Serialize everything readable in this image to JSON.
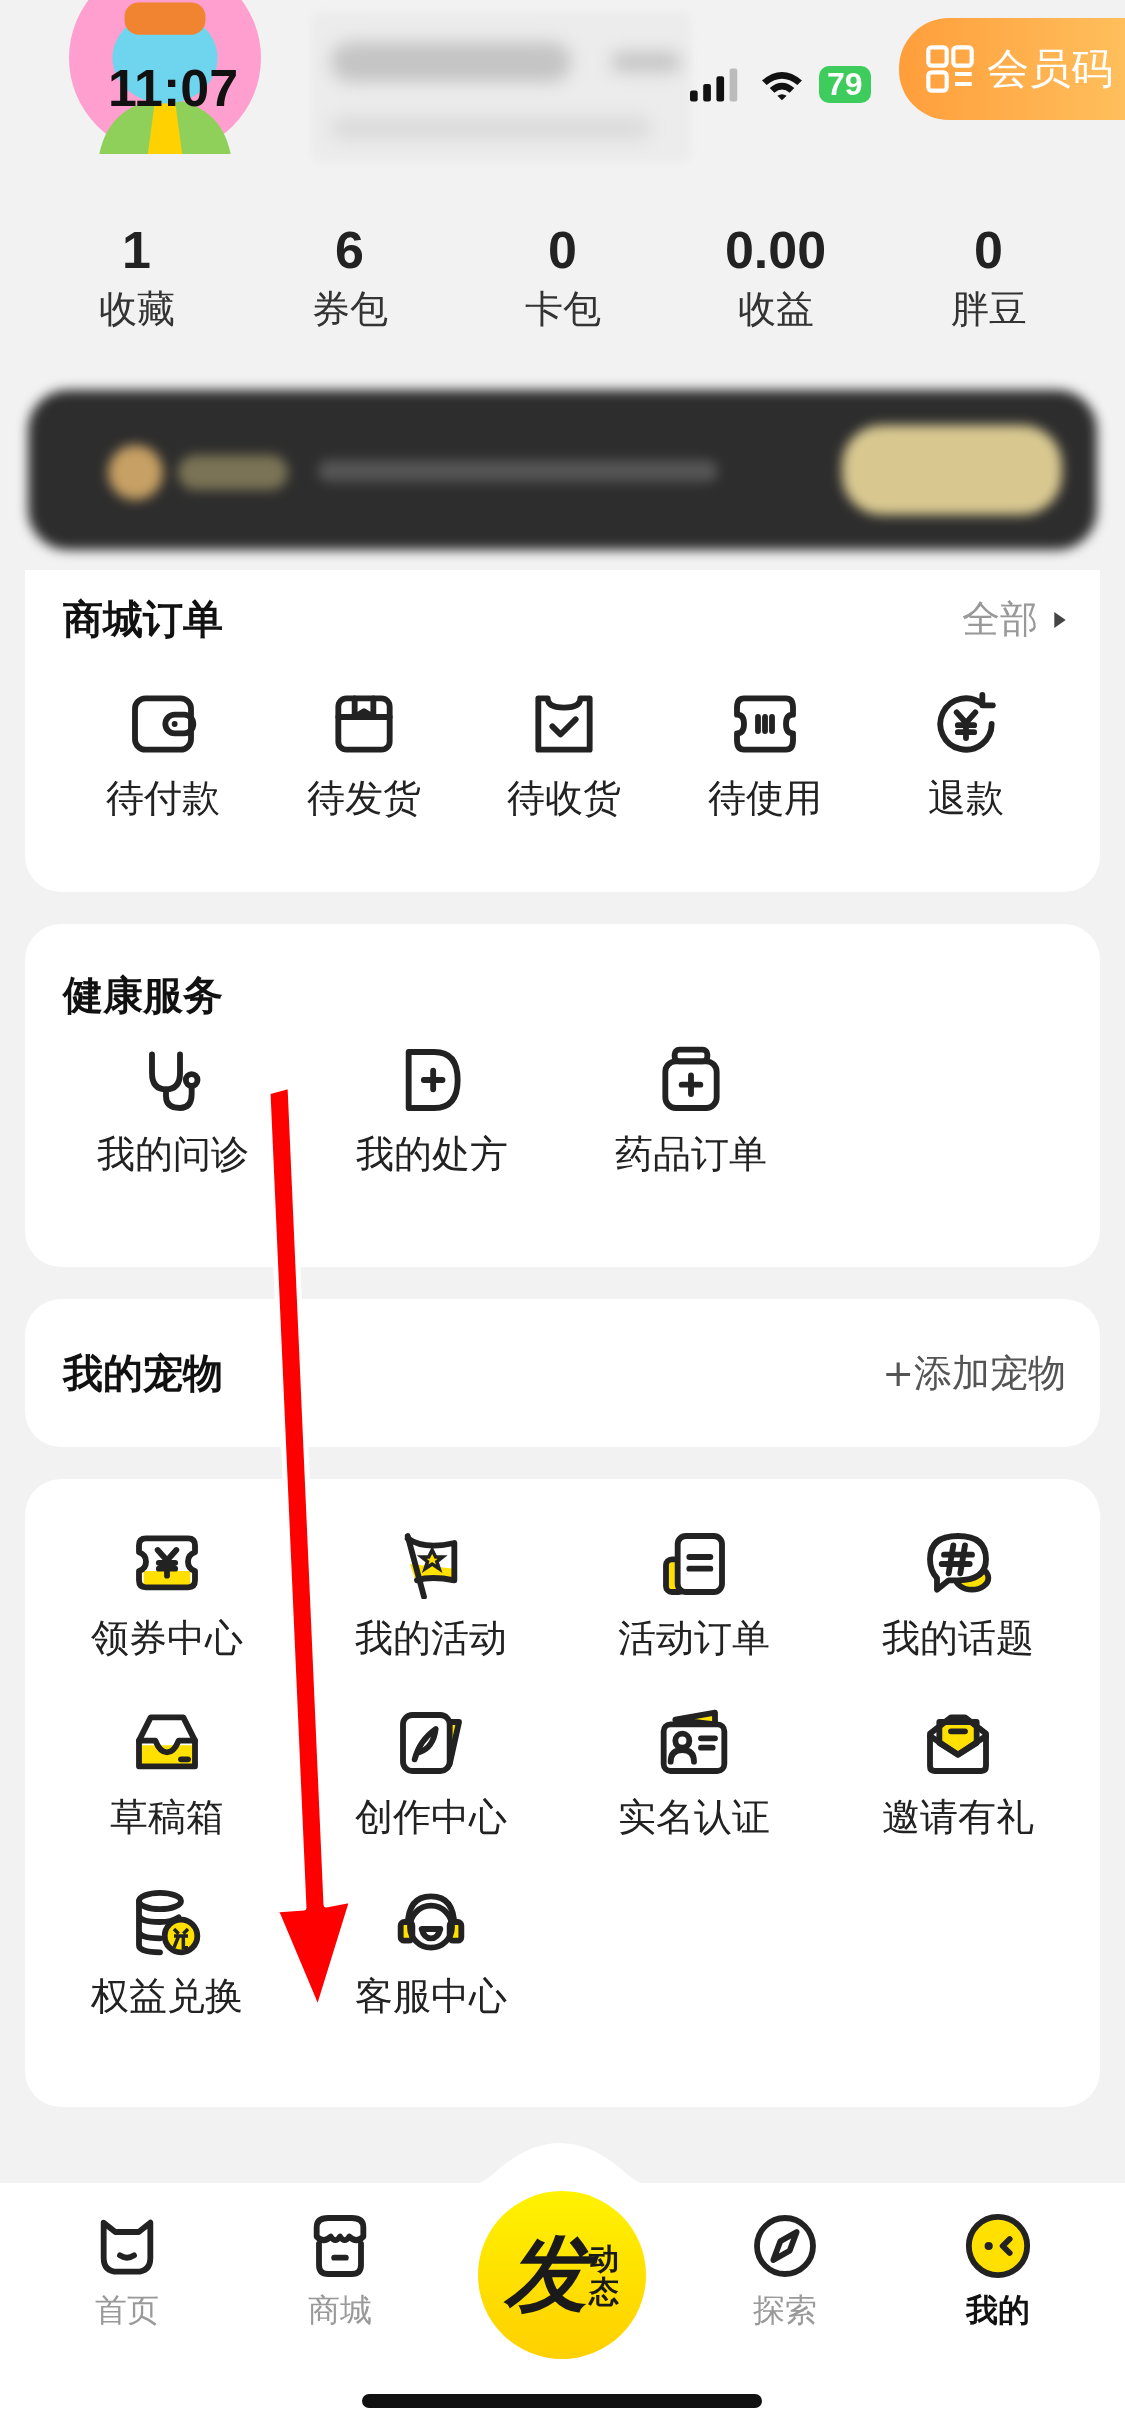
{
  "status_bar": {
    "time": "11:07",
    "battery": "79"
  },
  "member_code": {
    "label": "会员码"
  },
  "stats": [
    {
      "value": "1",
      "label": "收藏"
    },
    {
      "value": "6",
      "label": "券包"
    },
    {
      "value": "0",
      "label": "卡包"
    },
    {
      "value": "0.00",
      "label": "收益"
    },
    {
      "value": "0",
      "label": "胖豆"
    }
  ],
  "mall_orders": {
    "title": "商城订单",
    "more": "全部",
    "items": [
      "待付款",
      "待发货",
      "待收货",
      "待使用",
      "退款"
    ]
  },
  "health": {
    "title": "健康服务",
    "items": [
      "我的问诊",
      "我的处方",
      "药品订单"
    ]
  },
  "pets": {
    "title": "我的宠物",
    "action": "+添加宠物"
  },
  "services": [
    "领券中心",
    "我的活动",
    "活动订单",
    "我的话题",
    "草稿箱",
    "创作中心",
    "实名认证",
    "邀请有礼",
    "权益兑换",
    "客服中心"
  ],
  "post_button": {
    "main": "发",
    "sub": "动态"
  },
  "nav": [
    {
      "label": "首页",
      "selected": false
    },
    {
      "label": "商城",
      "selected": false
    },
    {
      "label": "探索",
      "selected": false
    },
    {
      "label": "我的",
      "selected": true
    }
  ]
}
